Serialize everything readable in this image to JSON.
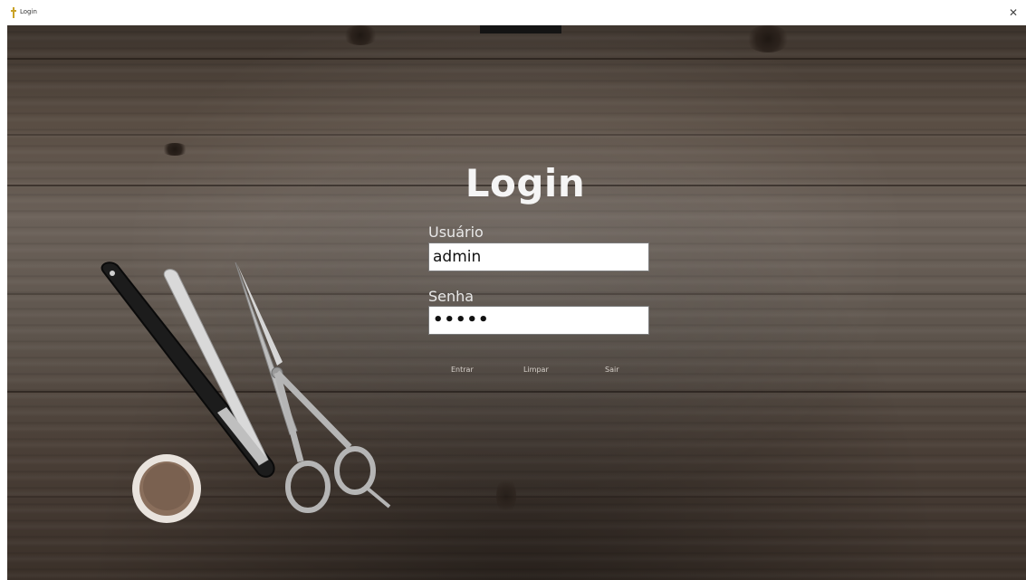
{
  "window": {
    "title": "Login",
    "close_glyph": "✕"
  },
  "form": {
    "heading": "Login",
    "username_label": "Usuário",
    "username_value": "admin",
    "password_label": "Senha",
    "password_value": "•••••"
  },
  "actions": {
    "enter": "Entrar",
    "clear": "Limpar",
    "exit": "Sair"
  },
  "icons": {
    "app": "app-icon",
    "close": "close-icon"
  },
  "colors": {
    "background_wood": "#5a4e44",
    "heading_text": "#f5f5f5",
    "input_bg": "#ffffff"
  }
}
